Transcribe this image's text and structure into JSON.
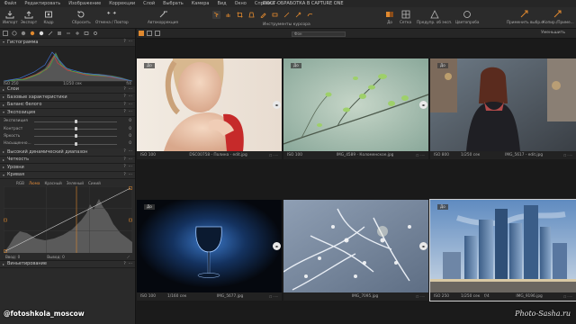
{
  "menu": [
    "Файл",
    "Редактировать",
    "Изображение",
    "Коррекции",
    "Слой",
    "Выбрать",
    "Камера",
    "Вид",
    "Окно",
    "Справка"
  ],
  "app_title": "ПОСТ-ОБРАБОТКА В CAPTURE ONE",
  "toolbar": {
    "import": "Импорт",
    "export": "Экспорт",
    "frame": "Кадр",
    "reset": "Сбросить",
    "undo_redo": "Отмена / Повтор",
    "autocorrect": "Автокоррекция",
    "cursor_tools": "Инструменты курсора",
    "before": "До",
    "grid": "Сетка",
    "preview": "Предупр. об эксп.",
    "color_test": "Цветопроба",
    "apply": "Применить выбр.е",
    "copy_apply": "Копир./Приме..."
  },
  "panels": {
    "histogram": "Гистограмма",
    "histo_iso": "ISO 250",
    "histo_shutter": "1/250 сек",
    "histo_aperture": "f/4",
    "layers": "Слои",
    "base_char": "Базовые характеристики",
    "white_balance": "Баланс белого",
    "exposure": "Экспозиция",
    "hdr": "Высокий динамический диапазон",
    "clarity": "Четкость",
    "levels": "Уровни",
    "curve": "Кривая",
    "vignetting": "Виньетирование"
  },
  "exposure_rows": [
    {
      "label": "Экспозиция",
      "value": "0",
      "position": 0.5
    },
    {
      "label": "Контраст",
      "value": "0",
      "position": 0.5
    },
    {
      "label": "Яркость",
      "value": "0",
      "position": 0.5
    },
    {
      "label": "Насыщенно...",
      "value": "0",
      "position": 0.5
    }
  ],
  "curve_tabs": [
    "RGB",
    "Люма",
    "Красный",
    "Зеленый",
    "Синий"
  ],
  "curve_active_tab": "Люма",
  "curve_input": "Ввод:",
  "curve_input_val": "0",
  "curve_output": "Вывод:",
  "curve_output_val": "0",
  "browser": {
    "filter_placeholder": "Фон",
    "sort_label": "Уменьшить"
  },
  "thumbs": [
    {
      "iso": "ISO 100",
      "shutter": "",
      "aperture": "",
      "fname": "DSC00758 - Полина - edit.jpg",
      "badge": "До",
      "split": true
    },
    {
      "iso": "ISO 100",
      "shutter": "",
      "aperture": "",
      "fname": "IMG_4589 - Коломенское.jpg",
      "badge": "До",
      "split": true
    },
    {
      "iso": "ISO 800",
      "shutter": "1/250 сек",
      "aperture": "",
      "fname": "IMG_5617 - edit.jpg",
      "badge": "До",
      "split": false
    },
    {
      "iso": "ISO 100",
      "shutter": "1/160 сек",
      "aperture": "",
      "fname": "IMG_5677.jpg",
      "badge": "До",
      "split": true
    },
    {
      "iso": "",
      "shutter": "",
      "aperture": "",
      "fname": "IMG_7095.jpg",
      "badge": "",
      "split": true
    },
    {
      "iso": "ISO 250",
      "shutter": "1/250 сек",
      "aperture": "f/4",
      "fname": "IMG_9196.jpg",
      "badge": "До",
      "split": false
    }
  ],
  "watermark_left": "@fotoshkola_moscow",
  "watermark_right": "Photo-Sasha.ru",
  "colors": {
    "accent": "#e0892f",
    "panel": "#2a2a2a",
    "bg": "#1a1a1a"
  }
}
